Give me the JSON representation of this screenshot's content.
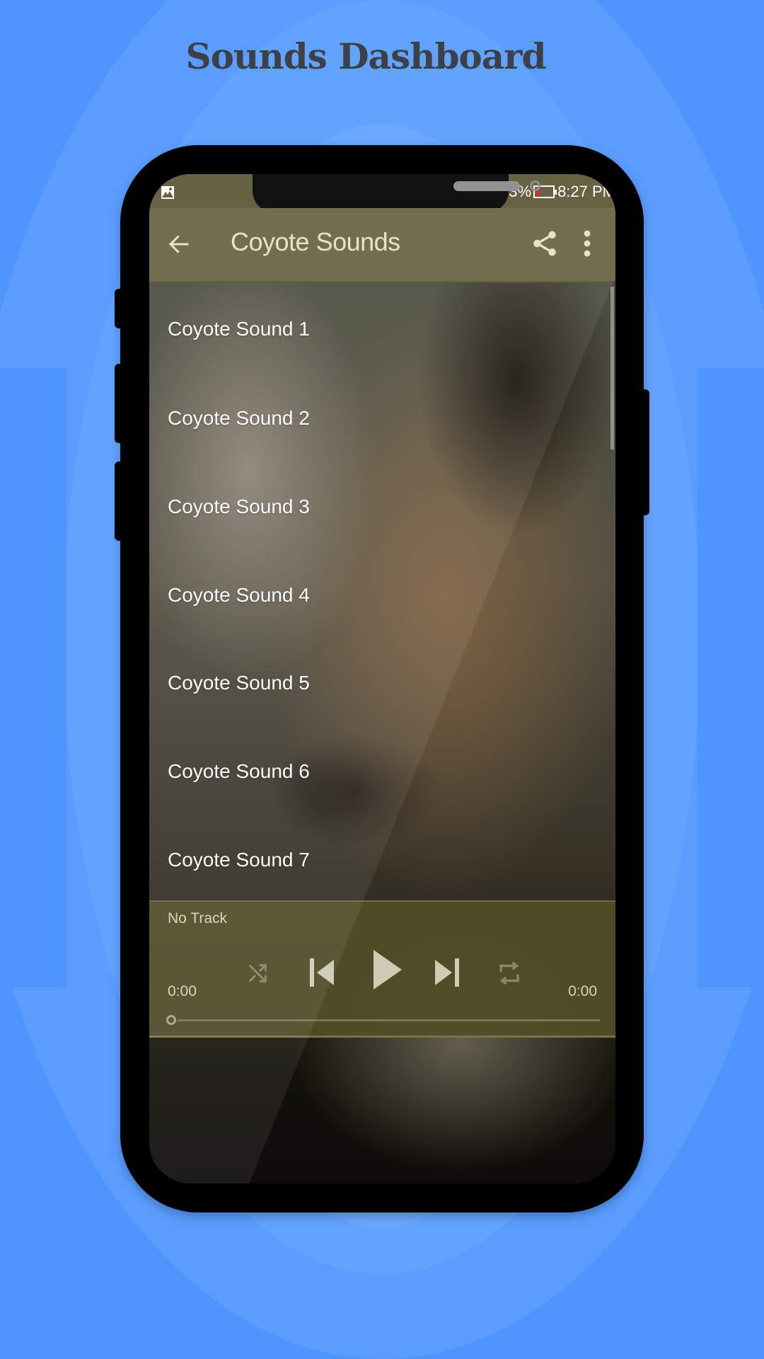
{
  "promo": {
    "headline": "Sounds Dashboard"
  },
  "statusbar": {
    "battery_text": "3%",
    "time": "8:27 PM",
    "battery_level_fraction": 0.03,
    "battery_low_color": "#d02020",
    "left_icon": "image-notification-icon"
  },
  "appbar": {
    "title": "Coyote Sounds",
    "back_icon": "arrow-left-icon",
    "share_icon": "share-icon",
    "more_icon": "more-vert-icon",
    "color": "#686340"
  },
  "sound_list": {
    "items": [
      {
        "label": "Coyote Sound 1"
      },
      {
        "label": "Coyote Sound 2"
      },
      {
        "label": "Coyote Sound 3"
      },
      {
        "label": "Coyote Sound 4"
      },
      {
        "label": "Coyote Sound 5"
      },
      {
        "label": "Coyote Sound 6"
      },
      {
        "label": "Coyote Sound 7"
      }
    ]
  },
  "player": {
    "track_title": "No Track",
    "elapsed": "0:00",
    "duration": "0:00",
    "progress_fraction": 0,
    "controls": [
      "shuffle",
      "previous",
      "play",
      "next",
      "repeat"
    ],
    "color": "#524e28"
  },
  "theme": {
    "background_blue": "#4f95fe",
    "headline_color": "#3d4047"
  }
}
